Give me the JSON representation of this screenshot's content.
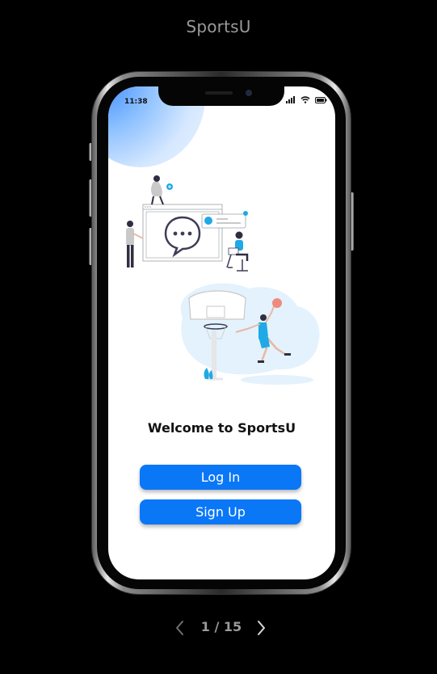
{
  "header": {
    "title": "SportsU"
  },
  "status_bar": {
    "time": "11:38"
  },
  "welcome": {
    "title": "Welcome to SportsU"
  },
  "actions": {
    "login_label": "Log In",
    "signup_label": "Sign Up"
  },
  "pager": {
    "text": "1 / 15",
    "prev_icon": "chevron-left-icon",
    "next_icon": "chevron-right-icon"
  },
  "colors": {
    "primary": "#0a77f7",
    "background": "#000000",
    "accent_cyan": "#1fa9e6"
  },
  "icons": [
    "cellular-signal-icon",
    "wifi-icon",
    "battery-icon"
  ]
}
